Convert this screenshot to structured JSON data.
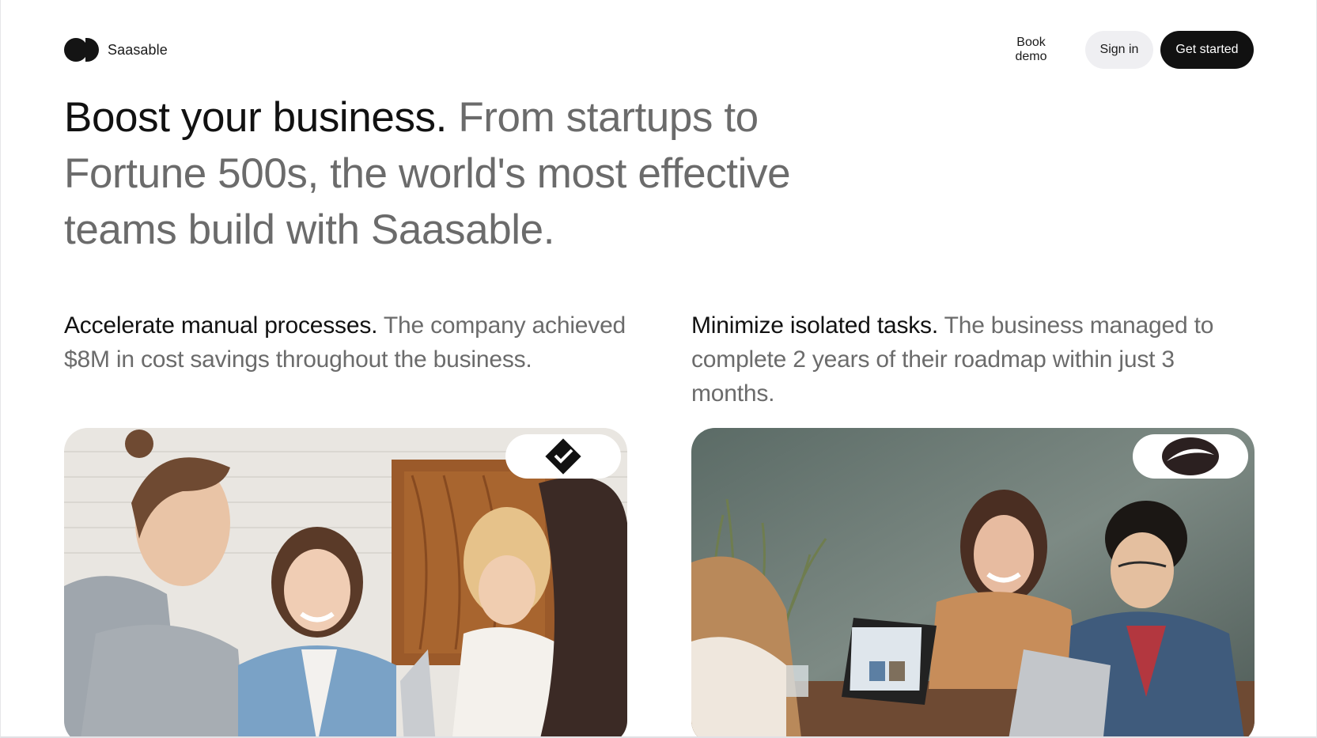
{
  "brand": {
    "name": "Saasable",
    "logo_icon": "two-circle-logo-icon"
  },
  "nav": {
    "book_demo": "Book demo",
    "sign_in": "Sign in",
    "get_started": "Get started"
  },
  "hero": {
    "lead": "Boost your business.",
    "rest": "From startups to Fortune 500s, the world's most effective teams build with Saasable."
  },
  "cards": [
    {
      "headline": "Accelerate manual processes.",
      "body": "The company achieved $8M in cost savings throughout the business.",
      "badge_icon": "diamond-check-logo-icon",
      "image": "team-meeting-photo"
    },
    {
      "headline": "Minimize isolated tasks.",
      "body": "The business managed to complete 2 years of their roadmap within just 3 months.",
      "badge_icon": "swoosh-oval-logo-icon",
      "image": "team-laptop-photo"
    }
  ],
  "colors": {
    "text_primary": "#111111",
    "text_muted": "#6b6b6b",
    "button_dark": "#111111",
    "button_light": "#efeff2"
  }
}
